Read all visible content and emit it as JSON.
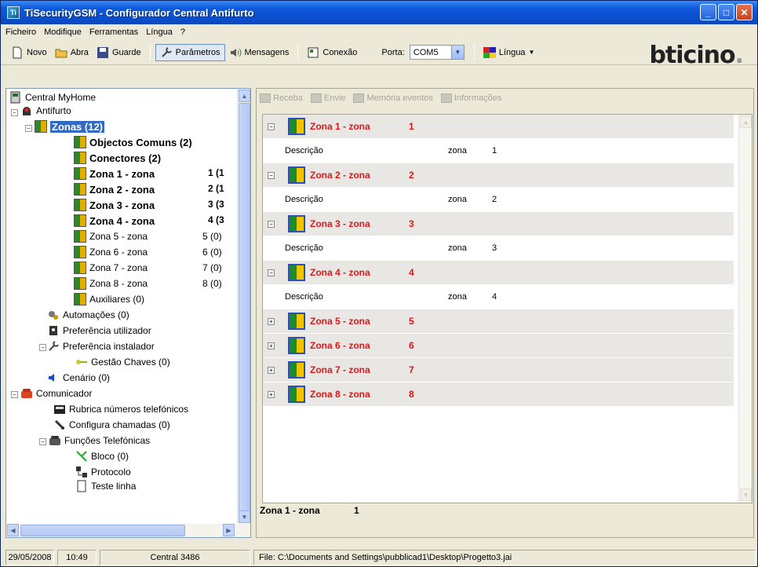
{
  "window": {
    "title": "TiSecurityGSM - Configurador Central Antifurto",
    "app_icon": "Ti"
  },
  "menu": [
    "Ficheiro",
    "Modifique",
    "Ferramentas",
    "Língua",
    "?"
  ],
  "toolbar": {
    "novo": "Novo",
    "abra": "Abra",
    "guarde": "Guarde",
    "parametros": "Parâmetros",
    "mensagens": "Mensagens",
    "conexao": "Conexão",
    "porta_label": "Porta:",
    "porta_value": "COM5",
    "lingua": "Língua",
    "brand": "bticino",
    "brand_dot": "."
  },
  "tree": {
    "root": "Central MyHome",
    "antifurto": "Antifurto",
    "zonas": "Zonas (12)",
    "objectos": "Objectos Comuns (2)",
    "conectores": "Conectores (2)",
    "zones": [
      {
        "label": "Zona 1 - zona",
        "num": "1 (1"
      },
      {
        "label": "Zona 2 - zona",
        "num": "2 (1"
      },
      {
        "label": "Zona 3 - zona",
        "num": "3 (3"
      },
      {
        "label": "Zona 4 - zona",
        "num": "4 (3"
      },
      {
        "label": "Zona 5 - zona",
        "num": "5 (0)"
      },
      {
        "label": "Zona 6 - zona",
        "num": "6 (0)"
      },
      {
        "label": "Zona 7 - zona",
        "num": "7 (0)"
      },
      {
        "label": "Zona 8 - zona",
        "num": "8 (0)"
      }
    ],
    "auxiliares": "Auxiliares (0)",
    "automacoes": "Automações (0)",
    "pref_utilizador": "Preferência utilizador",
    "pref_instalador": "Preferência instalador",
    "gestao_chaves": "Gestão Chaves (0)",
    "cenario": "Cenário (0)",
    "comunicador": "Comunicador",
    "rubrica": "Rubrica números telefónicos",
    "configura": "Configura chamadas (0)",
    "funcoes": "Funções Telefónicas",
    "bloco": "Bloco (0)",
    "protocolo": "Protocolo",
    "teste": "Teste linha"
  },
  "right_toolbar": [
    "Receba",
    "Envie",
    "Memória eventos",
    "Informações"
  ],
  "grid": {
    "expanded_zones": [
      {
        "name": "Zona 1 - zona",
        "num": "1",
        "desc_key": "Descrição",
        "desc_type": "zona",
        "desc_num": "1"
      },
      {
        "name": "Zona 2 - zona",
        "num": "2",
        "desc_key": "Descrição",
        "desc_type": "zona",
        "desc_num": "2"
      },
      {
        "name": "Zona 3 - zona",
        "num": "3",
        "desc_key": "Descrição",
        "desc_type": "zona",
        "desc_num": "3"
      },
      {
        "name": "Zona 4 - zona",
        "num": "4",
        "desc_key": "Descrição",
        "desc_type": "zona",
        "desc_num": "4"
      }
    ],
    "collapsed_zones": [
      {
        "name": "Zona 5 - zona",
        "num": "5"
      },
      {
        "name": "Zona 6 - zona",
        "num": "6"
      },
      {
        "name": "Zona 7 - zona",
        "num": "7"
      },
      {
        "name": "Zona 8 - zona",
        "num": "8"
      }
    ]
  },
  "caption": {
    "name": "Zona 1 - zona",
    "num": "1"
  },
  "status": {
    "date": "29/05/2008",
    "time": "10:49",
    "central": "Central 3486",
    "file": "File: C:\\Documents and Settings\\pubblicad1\\Desktop\\Progetto3.jai"
  },
  "colors": {
    "zone_red": "#e0171a",
    "title_blue": "#0a4fd0",
    "selected": "#316ac5"
  }
}
